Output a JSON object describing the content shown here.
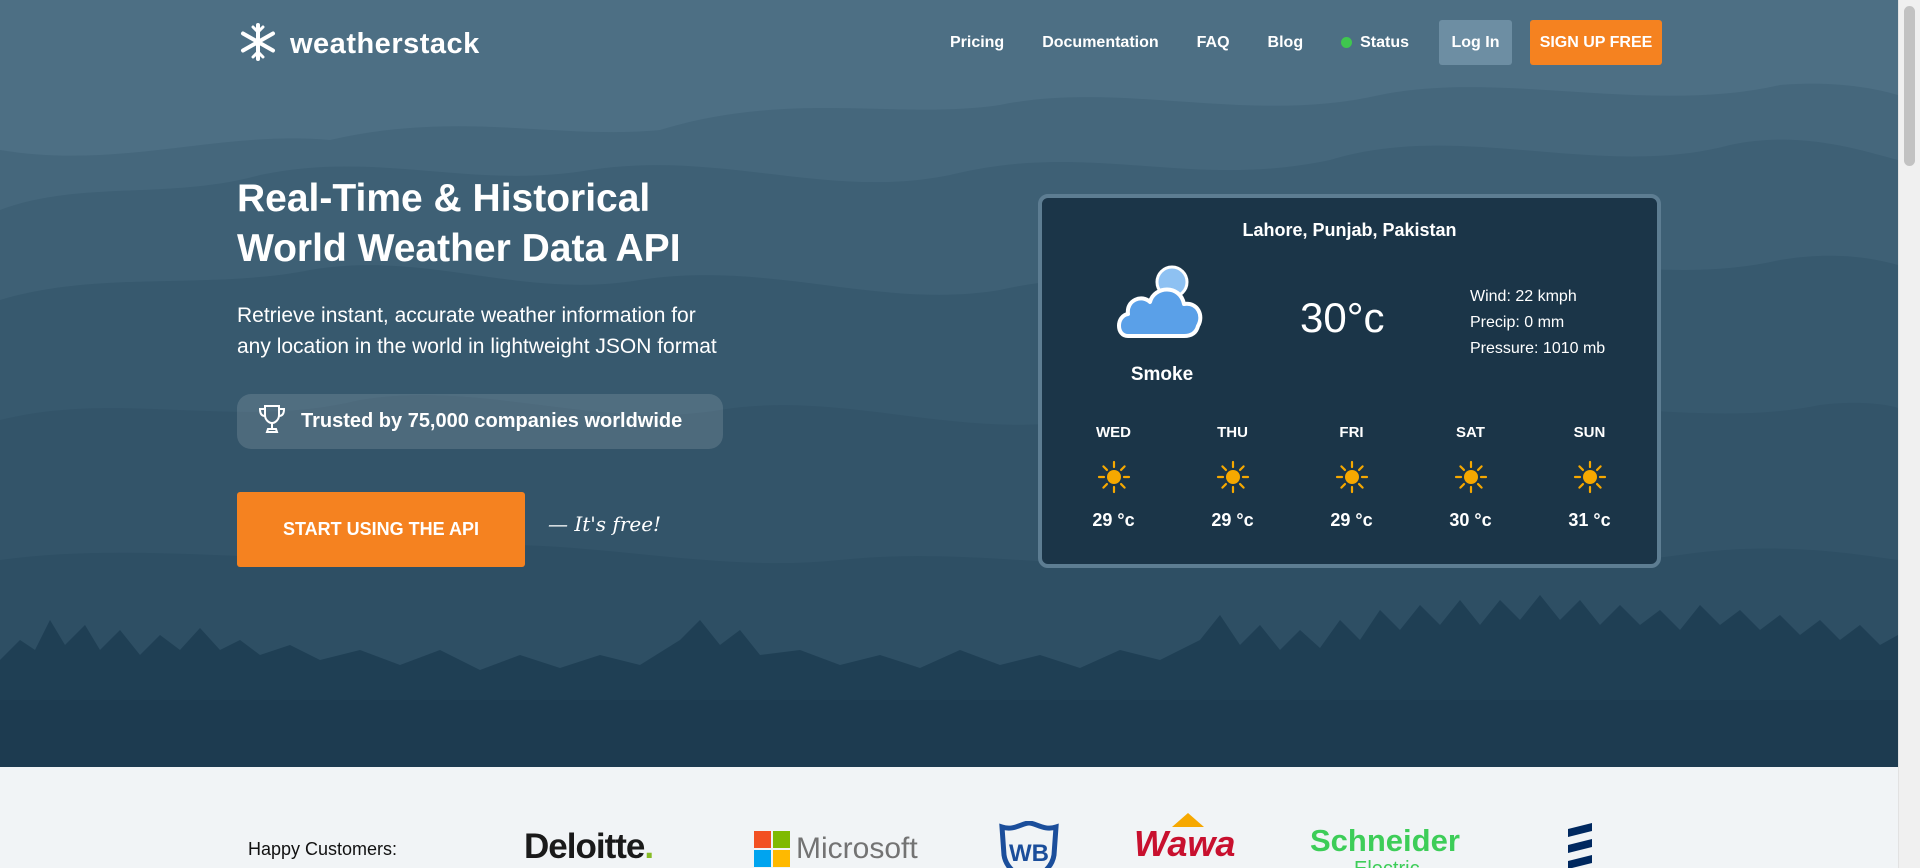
{
  "brand": {
    "name": "weatherstack"
  },
  "nav": {
    "items": [
      {
        "label": "Pricing"
      },
      {
        "label": "Documentation"
      },
      {
        "label": "FAQ"
      },
      {
        "label": "Blog"
      },
      {
        "label": "Status"
      }
    ],
    "login_label": "Log In",
    "signup_label": "SIGN UP FREE"
  },
  "hero": {
    "title_line1": "Real-Time & Historical",
    "title_line2": "World Weather Data API",
    "subtitle_line1": "Retrieve instant, accurate weather information for",
    "subtitle_line2": "any location in the world in lightweight JSON format",
    "trusted_text": "Trusted by 75,000 companies worldwide",
    "cta_label": "START USING THE API",
    "free_note": "— It's free!"
  },
  "weather_card": {
    "location": "Lahore, Punjab, Pakistan",
    "condition": "Smoke",
    "temperature": "30°c",
    "wind": "Wind: 22 kmph",
    "precip": "Precip: 0 mm",
    "pressure": "Pressure: 1010 mb",
    "forecast": [
      {
        "day": "WED",
        "temp": "29 °c",
        "icon": "sun-icon"
      },
      {
        "day": "THU",
        "temp": "29 °c",
        "icon": "sun-icon"
      },
      {
        "day": "FRI",
        "temp": "29 °c",
        "icon": "sun-icon"
      },
      {
        "day": "SAT",
        "temp": "30 °c",
        "icon": "sun-icon"
      },
      {
        "day": "SUN",
        "temp": "31 °c",
        "icon": "sun-icon"
      }
    ]
  },
  "customers": {
    "label": "Happy Customers:",
    "logos": {
      "deloitte": "Deloitte",
      "deloitte_dot": ".",
      "microsoft": "Microsoft",
      "wb": "WB",
      "wawa": "Wawa",
      "schneider": "Schneider",
      "schneider_sub": "Electric"
    }
  },
  "colors": {
    "hero_bg": "#4a6b80",
    "accent": "#f58220",
    "card_bg": "#1b3548",
    "status_green": "#3fc64f",
    "sun": "#f6a800",
    "cloud": "#5aa0e8"
  }
}
